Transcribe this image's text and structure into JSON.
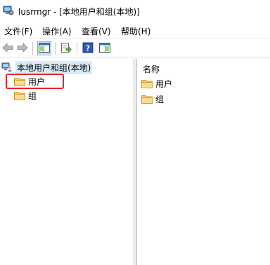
{
  "window": {
    "title": "lusrmgr - [本地用户和组(本地)]"
  },
  "menu": [
    {
      "label": "文件(F)"
    },
    {
      "label": "操作(A)"
    },
    {
      "label": "查看(V)"
    },
    {
      "label": "帮助(H)"
    }
  ],
  "toolbar": {
    "buttons": [
      {
        "icon": "back-arrow-icon"
      },
      {
        "icon": "forward-arrow-icon"
      },
      {
        "icon": "show-hide-console-tree-icon",
        "pressed": true
      },
      {
        "icon": "export-list-icon"
      },
      {
        "icon": "help-icon"
      },
      {
        "icon": "show-hide-action-pane-icon"
      }
    ]
  },
  "tree": {
    "root_label": "本地用户和组(本地)",
    "items": [
      {
        "label": "用户",
        "highlighted": true
      },
      {
        "label": "组"
      }
    ]
  },
  "list": {
    "column_header": "名称",
    "items": [
      {
        "label": "用户"
      },
      {
        "label": "组"
      }
    ]
  },
  "colors": {
    "selection_bg": "#d9ebf9",
    "highlight_box": "#e8232a",
    "folder_yellow": "#f2c55c"
  }
}
